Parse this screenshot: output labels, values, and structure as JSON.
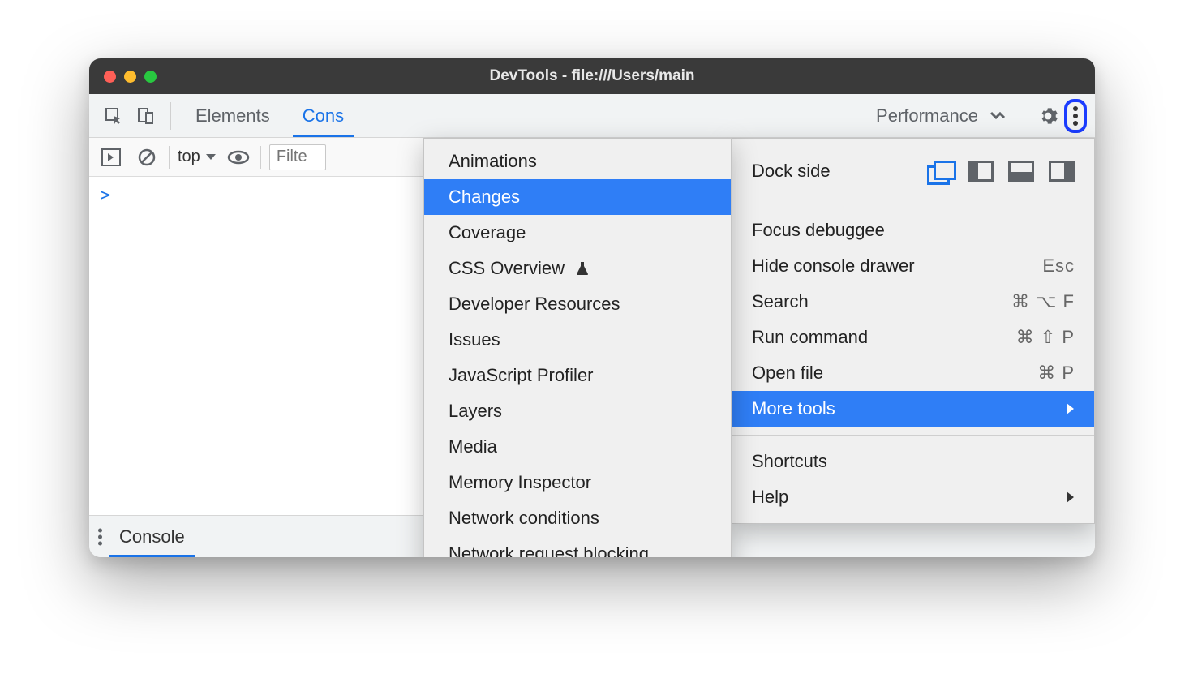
{
  "window": {
    "title": "DevTools - file:///Users/main"
  },
  "tabs": {
    "elements": "Elements",
    "console_partial": "Cons",
    "performance_partial": "Performance"
  },
  "consoleBar": {
    "context": "top",
    "filter_placeholder": "Filte"
  },
  "console": {
    "prompt": ">"
  },
  "drawer": {
    "tab": "Console"
  },
  "menu": {
    "dockSide": "Dock side",
    "focusDebuggee": "Focus debuggee",
    "hideConsole": "Hide console drawer",
    "hideConsoleShortcut": "Esc",
    "search": "Search",
    "searchShortcut": "⌘ ⌥ F",
    "runCommand": "Run command",
    "runCommandShortcut": "⌘ ⇧ P",
    "openFile": "Open file",
    "openFileShortcut": "⌘ P",
    "moreTools": "More tools",
    "shortcuts": "Shortcuts",
    "help": "Help"
  },
  "submenu": {
    "items": [
      "Animations",
      "Changes",
      "Coverage",
      "CSS Overview",
      "Developer Resources",
      "Issues",
      "JavaScript Profiler",
      "Layers",
      "Media",
      "Memory Inspector",
      "Network conditions",
      "Network request blocking"
    ],
    "experimentIndex": 3,
    "highlightIndex": 1
  }
}
